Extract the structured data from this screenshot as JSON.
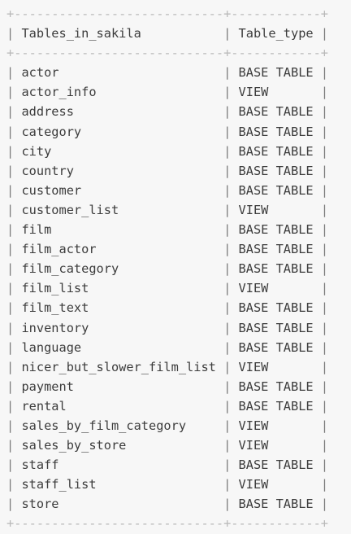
{
  "columns": [
    "Tables_in_sakila",
    "Table_type"
  ],
  "rows": [
    [
      "actor",
      "BASE TABLE"
    ],
    [
      "actor_info",
      "VIEW"
    ],
    [
      "address",
      "BASE TABLE"
    ],
    [
      "category",
      "BASE TABLE"
    ],
    [
      "city",
      "BASE TABLE"
    ],
    [
      "country",
      "BASE TABLE"
    ],
    [
      "customer",
      "BASE TABLE"
    ],
    [
      "customer_list",
      "VIEW"
    ],
    [
      "film",
      "BASE TABLE"
    ],
    [
      "film_actor",
      "BASE TABLE"
    ],
    [
      "film_category",
      "BASE TABLE"
    ],
    [
      "film_list",
      "VIEW"
    ],
    [
      "film_text",
      "BASE TABLE"
    ],
    [
      "inventory",
      "BASE TABLE"
    ],
    [
      "language",
      "BASE TABLE"
    ],
    [
      "nicer_but_slower_film_list",
      "VIEW"
    ],
    [
      "payment",
      "BASE TABLE"
    ],
    [
      "rental",
      "BASE TABLE"
    ],
    [
      "sales_by_film_category",
      "VIEW"
    ],
    [
      "sales_by_store",
      "VIEW"
    ],
    [
      "staff",
      "BASE TABLE"
    ],
    [
      "staff_list",
      "VIEW"
    ],
    [
      "store",
      "BASE TABLE"
    ]
  ]
}
